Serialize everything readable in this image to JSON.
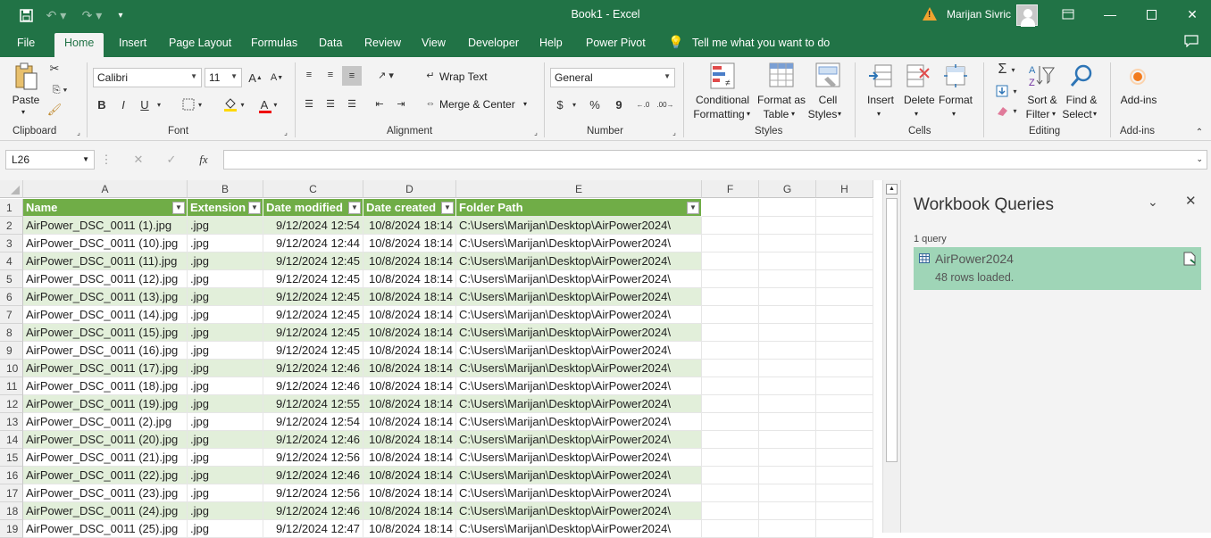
{
  "app": {
    "title": "Book1  -  Excel",
    "user": "Marijan Sivric"
  },
  "menu": [
    "File",
    "Home",
    "Insert",
    "Page Layout",
    "Formulas",
    "Data",
    "Review",
    "View",
    "Developer",
    "Help",
    "Power Pivot"
  ],
  "tell_me": "Tell me what you want to do",
  "ribbon": {
    "clipboard": {
      "paste": "Paste",
      "label": "Clipboard"
    },
    "font": {
      "name": "Calibri",
      "size": "11",
      "label": "Font",
      "bold": "B",
      "italic": "I",
      "underline": "U"
    },
    "alignment": {
      "wrap": "Wrap Text",
      "merge": "Merge & Center",
      "label": "Alignment"
    },
    "number": {
      "format": "General",
      "label": "Number",
      "currency": "$",
      "percent": "%",
      "comma": "9"
    },
    "styles": {
      "conditional1": "Conditional",
      "conditional2": "Formatting",
      "format_table1": "Format as",
      "format_table2": "Table",
      "cell_styles1": "Cell",
      "cell_styles2": "Styles",
      "label": "Styles"
    },
    "cells": {
      "insert": "Insert",
      "delete": "Delete",
      "format": "Format",
      "label": "Cells"
    },
    "editing": {
      "sort1": "Sort &",
      "sort2": "Filter",
      "find1": "Find &",
      "find2": "Select",
      "label": "Editing"
    },
    "addins": {
      "button": "Add-ins",
      "label": "Add-ins"
    }
  },
  "formula_bar": {
    "name_box": "L26",
    "fx": "fx",
    "formula": ""
  },
  "columns": [
    "A",
    "B",
    "C",
    "D",
    "E",
    "F",
    "G",
    "H"
  ],
  "headers": [
    "Name",
    "Extension",
    "Date modified",
    "Date created",
    "Folder Path"
  ],
  "rows": [
    [
      "AirPower_DSC_0011 (1).jpg",
      ".jpg",
      "9/12/2024 12:54",
      "10/8/2024 18:14",
      "C:\\Users\\Marijan\\Desktop\\AirPower2024\\"
    ],
    [
      "AirPower_DSC_0011 (10).jpg",
      ".jpg",
      "9/12/2024 12:44",
      "10/8/2024 18:14",
      "C:\\Users\\Marijan\\Desktop\\AirPower2024\\"
    ],
    [
      "AirPower_DSC_0011 (11).jpg",
      ".jpg",
      "9/12/2024 12:45",
      "10/8/2024 18:14",
      "C:\\Users\\Marijan\\Desktop\\AirPower2024\\"
    ],
    [
      "AirPower_DSC_0011 (12).jpg",
      ".jpg",
      "9/12/2024 12:45",
      "10/8/2024 18:14",
      "C:\\Users\\Marijan\\Desktop\\AirPower2024\\"
    ],
    [
      "AirPower_DSC_0011 (13).jpg",
      ".jpg",
      "9/12/2024 12:45",
      "10/8/2024 18:14",
      "C:\\Users\\Marijan\\Desktop\\AirPower2024\\"
    ],
    [
      "AirPower_DSC_0011 (14).jpg",
      ".jpg",
      "9/12/2024 12:45",
      "10/8/2024 18:14",
      "C:\\Users\\Marijan\\Desktop\\AirPower2024\\"
    ],
    [
      "AirPower_DSC_0011 (15).jpg",
      ".jpg",
      "9/12/2024 12:45",
      "10/8/2024 18:14",
      "C:\\Users\\Marijan\\Desktop\\AirPower2024\\"
    ],
    [
      "AirPower_DSC_0011 (16).jpg",
      ".jpg",
      "9/12/2024 12:45",
      "10/8/2024 18:14",
      "C:\\Users\\Marijan\\Desktop\\AirPower2024\\"
    ],
    [
      "AirPower_DSC_0011 (17).jpg",
      ".jpg",
      "9/12/2024 12:46",
      "10/8/2024 18:14",
      "C:\\Users\\Marijan\\Desktop\\AirPower2024\\"
    ],
    [
      "AirPower_DSC_0011 (18).jpg",
      ".jpg",
      "9/12/2024 12:46",
      "10/8/2024 18:14",
      "C:\\Users\\Marijan\\Desktop\\AirPower2024\\"
    ],
    [
      "AirPower_DSC_0011 (19).jpg",
      ".jpg",
      "9/12/2024 12:55",
      "10/8/2024 18:14",
      "C:\\Users\\Marijan\\Desktop\\AirPower2024\\"
    ],
    [
      "AirPower_DSC_0011 (2).jpg",
      ".jpg",
      "9/12/2024 12:54",
      "10/8/2024 18:14",
      "C:\\Users\\Marijan\\Desktop\\AirPower2024\\"
    ],
    [
      "AirPower_DSC_0011 (20).jpg",
      ".jpg",
      "9/12/2024 12:46",
      "10/8/2024 18:14",
      "C:\\Users\\Marijan\\Desktop\\AirPower2024\\"
    ],
    [
      "AirPower_DSC_0011 (21).jpg",
      ".jpg",
      "9/12/2024 12:56",
      "10/8/2024 18:14",
      "C:\\Users\\Marijan\\Desktop\\AirPower2024\\"
    ],
    [
      "AirPower_DSC_0011 (22).jpg",
      ".jpg",
      "9/12/2024 12:46",
      "10/8/2024 18:14",
      "C:\\Users\\Marijan\\Desktop\\AirPower2024\\"
    ],
    [
      "AirPower_DSC_0011 (23).jpg",
      ".jpg",
      "9/12/2024 12:56",
      "10/8/2024 18:14",
      "C:\\Users\\Marijan\\Desktop\\AirPower2024\\"
    ],
    [
      "AirPower_DSC_0011 (24).jpg",
      ".jpg",
      "9/12/2024 12:46",
      "10/8/2024 18:14",
      "C:\\Users\\Marijan\\Desktop\\AirPower2024\\"
    ],
    [
      "AirPower_DSC_0011 (25).jpg",
      ".jpg",
      "9/12/2024 12:47",
      "10/8/2024 18:14",
      "C:\\Users\\Marijan\\Desktop\\AirPower2024\\"
    ]
  ],
  "panel": {
    "title": "Workbook Queries",
    "count": "1 query",
    "query_name": "AirPower2024",
    "query_status": "48 rows loaded."
  },
  "colors": {
    "accent": "#217346",
    "table_header": "#70ad47",
    "band": "#e2efda",
    "query_card": "#9fd5b7"
  }
}
